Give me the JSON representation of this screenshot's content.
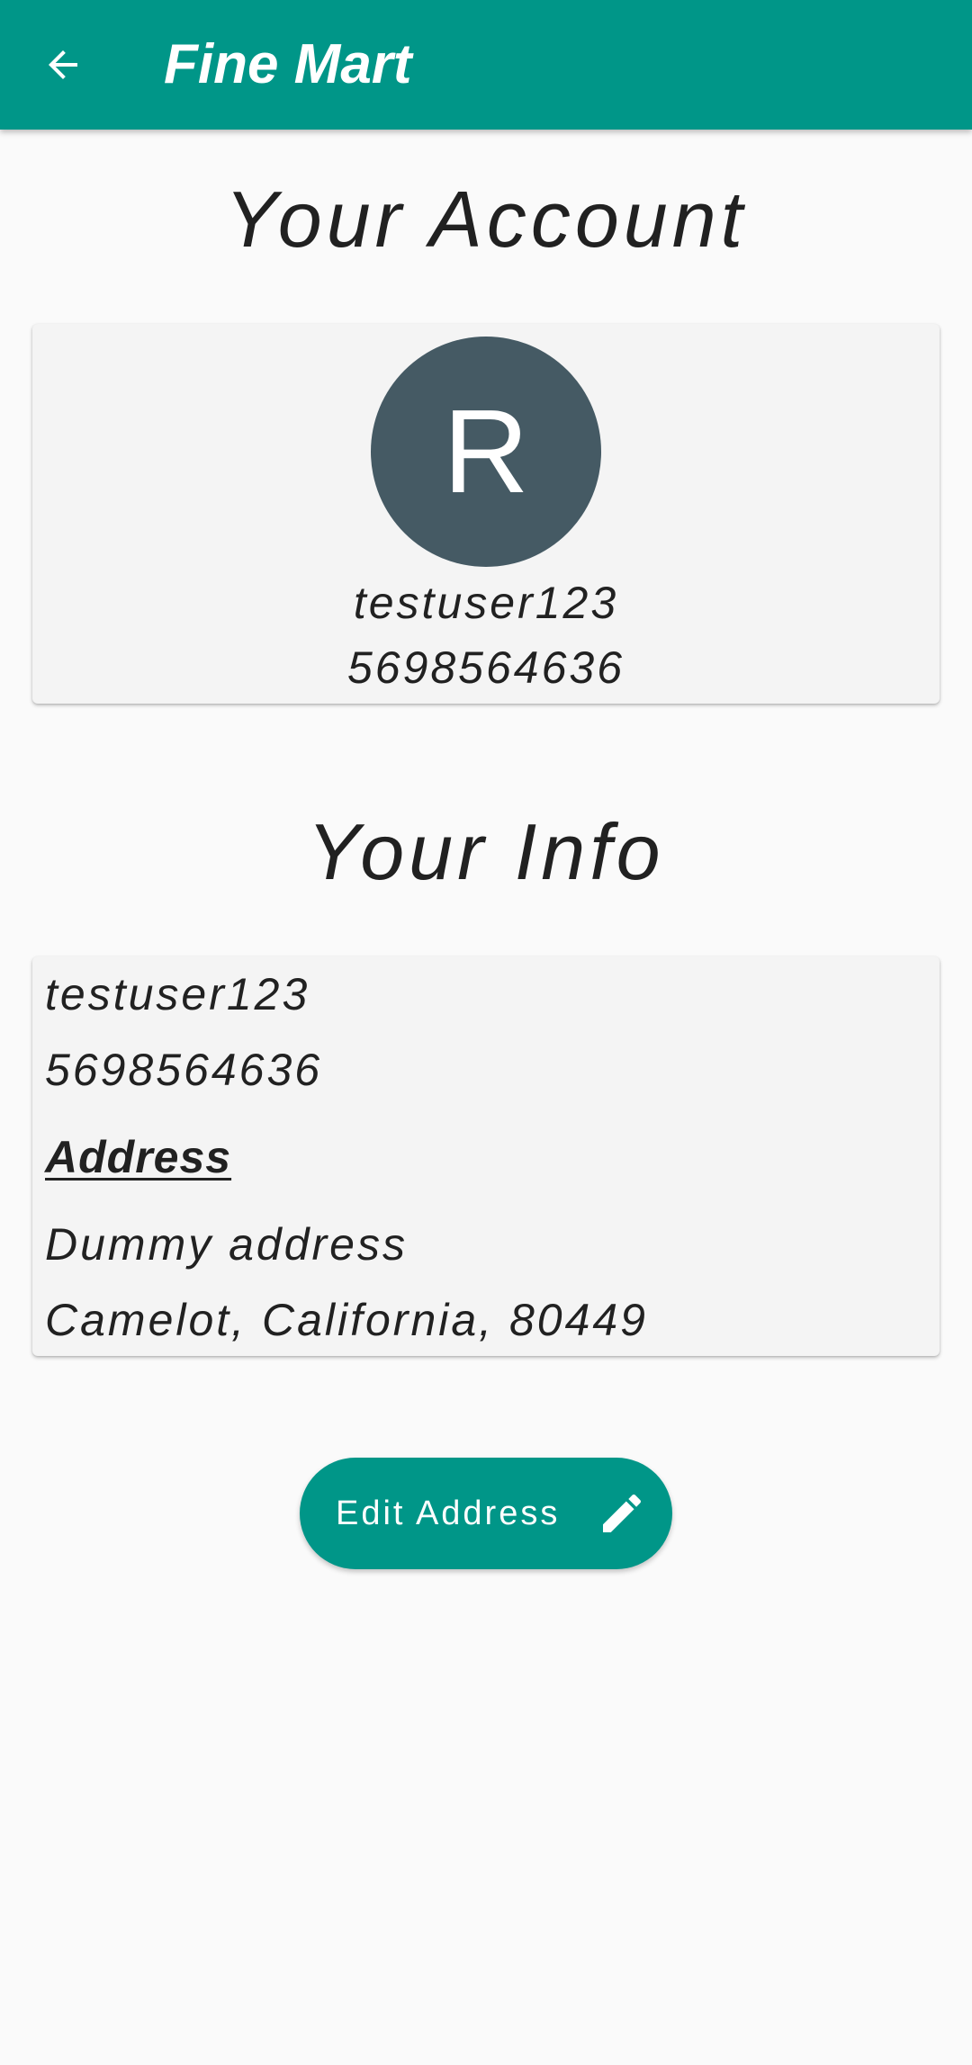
{
  "app_bar": {
    "title": "Fine Mart",
    "back_icon": "arrow-back-icon",
    "color": "#009688"
  },
  "account_section": {
    "heading": "Your Account",
    "avatar_initial": "R",
    "avatar_color": "#455a64",
    "username": "testuser123",
    "phone": "5698564636"
  },
  "info_section": {
    "heading": "Your Info",
    "username": "testuser123",
    "phone": "5698564636",
    "address_label": "Address",
    "address_line1": "Dummy address",
    "address_line2": "Camelot, California, 80449"
  },
  "edit_button": {
    "label": "Edit Address",
    "icon": "pencil-icon",
    "color": "#009688"
  }
}
